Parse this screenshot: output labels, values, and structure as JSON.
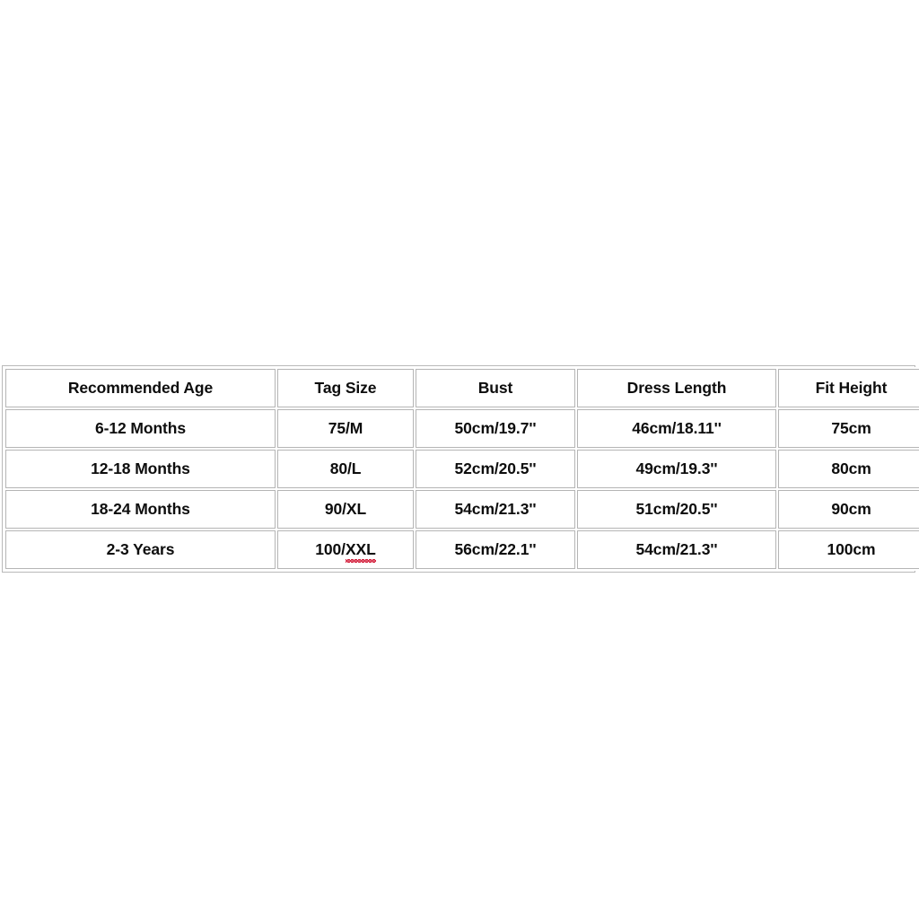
{
  "page": {
    "background_color": "#ffffff",
    "text_color": "#0d0d0d",
    "border_color": "#b5b5b5",
    "spellcheck_underline_color": "#d4213d"
  },
  "table": {
    "name": "size-chart",
    "columns": [
      {
        "key": "age",
        "header": "Recommended Age"
      },
      {
        "key": "tag",
        "header": "Tag Size"
      },
      {
        "key": "bust",
        "header": "Bust"
      },
      {
        "key": "dress",
        "header": "Dress Length"
      },
      {
        "key": "height",
        "header": "Fit Height"
      }
    ],
    "rows": [
      {
        "age": "6-12 Months",
        "tag": "75/M",
        "tag_plain": "75/M",
        "tag_misspelled": "",
        "bust": "50cm/19.7''",
        "dress": "46cm/18.11''",
        "height": "75cm"
      },
      {
        "age": "12-18 Months",
        "tag": "80/L",
        "tag_plain": "80/L",
        "tag_misspelled": "",
        "bust": "52cm/20.5''",
        "dress": "49cm/19.3''",
        "height": "80cm"
      },
      {
        "age": "18-24 Months",
        "tag": "90/XL",
        "tag_plain": "90/XL",
        "tag_misspelled": "",
        "bust": "54cm/21.3''",
        "dress": "51cm/20.5''",
        "height": "90cm"
      },
      {
        "age": "2-3 Years",
        "tag": "100/XXL",
        "tag_plain": "100/",
        "tag_misspelled": "XXL",
        "bust": "56cm/22.1''",
        "dress": "54cm/21.3''",
        "height": "100cm"
      }
    ]
  }
}
